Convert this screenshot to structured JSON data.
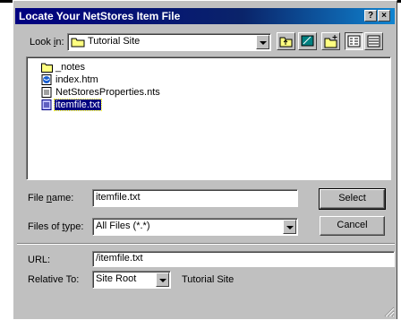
{
  "dialog": {
    "title": "Locate Your NetStores Item File",
    "help_label": "?",
    "close_label": "×"
  },
  "lookin": {
    "label_pre": "Look ",
    "label_ul": "i",
    "label_post": "n:",
    "value": "Tutorial Site"
  },
  "files": [
    {
      "name": "_notes",
      "icon": "folder-icon"
    },
    {
      "name": "index.htm",
      "icon": "html-file-icon"
    },
    {
      "name": "NetStoresProperties.nts",
      "icon": "document-icon"
    },
    {
      "name": "itemfile.txt",
      "icon": "text-file-icon",
      "selected": true
    }
  ],
  "filename": {
    "label_pre": "File ",
    "label_ul": "n",
    "label_post": "ame:",
    "value": "itemfile.txt"
  },
  "filetype": {
    "label_pre": "Files of ",
    "label_ul": "t",
    "label_post": "ype:",
    "value": "All Files (*.*)"
  },
  "buttons": {
    "select": "Select",
    "cancel": "Cancel"
  },
  "url": {
    "label": "URL:",
    "value": "/itemfile.txt"
  },
  "relative": {
    "label": "Relative To:",
    "value": "Site Root",
    "site_name": "Tutorial Site"
  }
}
